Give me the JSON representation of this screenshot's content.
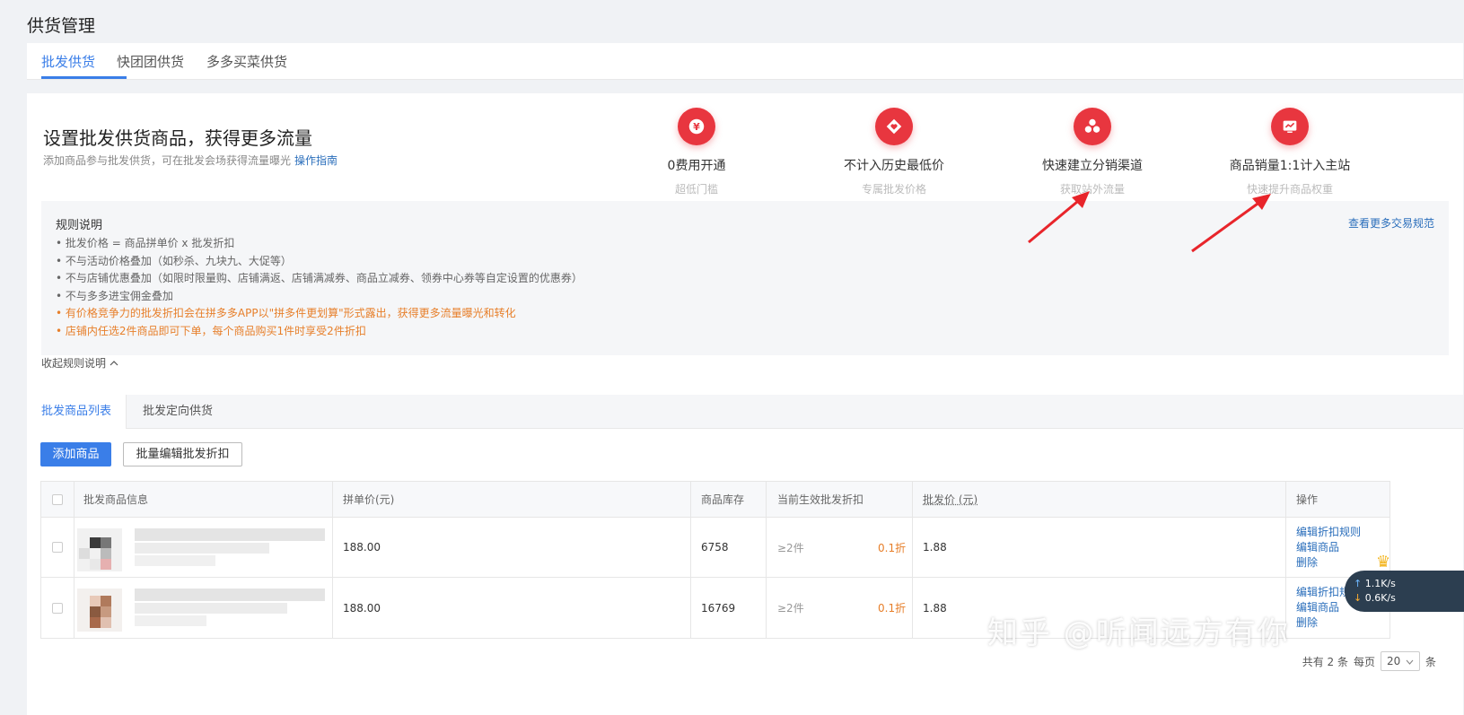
{
  "page_title": "供货管理",
  "top_tabs": [
    {
      "label": "批发供货",
      "active": true
    },
    {
      "label": "快团团供货",
      "active": false
    },
    {
      "label": "多多买菜供货",
      "active": false
    }
  ],
  "promo": {
    "title": "设置批发供货商品，获得更多流量",
    "subtitle": "添加商品参与批发供货，可在批发会场获得流量曝光",
    "guide_link": "操作指南",
    "features": [
      {
        "title": "0费用开通",
        "sub": "超低门槛",
        "icon": "yuan-icon"
      },
      {
        "title": "不计入历史最低价",
        "sub": "专属批发价格",
        "icon": "heart-tag-icon"
      },
      {
        "title": "快速建立分销渠道",
        "sub": "获取站外流量",
        "icon": "network-icon"
      },
      {
        "title": "商品销量1:1计入主站",
        "sub": "快速提升商品权重",
        "icon": "chart-icon"
      }
    ]
  },
  "rules": {
    "heading": "规则说明",
    "more_link": "查看更多交易规范",
    "items": [
      {
        "text": "批发价格 = 商品拼单价 x 批发折扣",
        "highlight": false
      },
      {
        "text": "不与活动价格叠加（如秒杀、九块九、大促等）",
        "highlight": false
      },
      {
        "text": "不与店铺优惠叠加（如限时限量购、店铺满返、店铺满减券、商品立减券、领券中心券等自定设置的优惠券）",
        "highlight": false
      },
      {
        "text": "不与多多进宝佣金叠加",
        "highlight": false
      },
      {
        "text": "有价格竞争力的批发折扣会在拼多多APP以\"拼多件更划算\"形式露出，获得更多流量曝光和转化",
        "highlight": true
      },
      {
        "text": "店铺内任选2件商品即可下单，每个商品购买1件时享受2件折扣",
        "highlight": true
      }
    ],
    "collapse_label": "收起规则说明",
    "collapse_icon": "chevron-up-icon"
  },
  "list": {
    "sub_tabs": [
      {
        "label": "批发商品列表",
        "active": true
      },
      {
        "label": "批发定向供货",
        "active": false
      }
    ],
    "add_button": "添加商品",
    "batch_button": "批量编辑批发折扣",
    "columns": [
      "批发商品信息",
      "拼单价(元)",
      "商品库存",
      "当前生效批发折扣",
      "批发价 (元)",
      "操作"
    ],
    "rows": [
      {
        "price": "188.00",
        "stock": "6758",
        "tier": "≥2件",
        "discount": "0.1折",
        "wholesale": "1.88",
        "ops": [
          "编辑折扣规则",
          "编辑商品",
          "删除"
        ]
      },
      {
        "price": "188.00",
        "stock": "16769",
        "tier": "≥2件",
        "discount": "0.1折",
        "wholesale": "1.88",
        "ops": [
          "编辑折扣规则",
          "编辑商品",
          "删除"
        ]
      }
    ],
    "pager": {
      "total": "共有 2 条",
      "per_page_label": "每页",
      "per_page": "20",
      "unit": "条"
    }
  },
  "overlay": {
    "watermark": "知乎 @听闻远方有你",
    "upload_speed": "1.1K/s",
    "download_speed": "0.6K/s"
  },
  "colors": {
    "accent": "#3a7ee8",
    "red": "#e8363f",
    "orange": "#e77f2a",
    "link": "#2a6ebb"
  }
}
